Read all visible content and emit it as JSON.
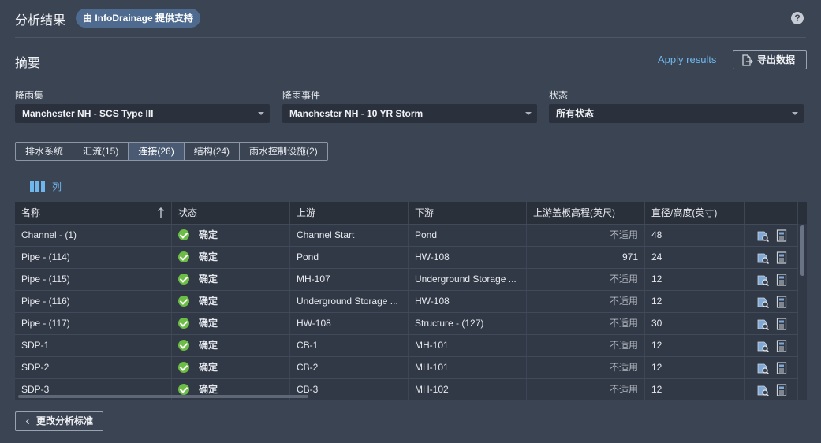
{
  "header": {
    "title": "分析结果",
    "badge": "由 InfoDrainage 提供支持",
    "help": "?"
  },
  "summary": {
    "title": "摘要",
    "apply_label": "Apply results",
    "export_label": "导出数据"
  },
  "filters": {
    "rainfall_set": {
      "label": "降雨集",
      "value": "Manchester NH - SCS Type III"
    },
    "rainfall_event": {
      "label": "降雨事件",
      "value": "Manchester NH - 10 YR Storm"
    },
    "status": {
      "label": "状态",
      "value": "所有状态"
    }
  },
  "tabs": [
    {
      "label": "排水系统",
      "active": false
    },
    {
      "label": "汇流(15)",
      "active": false
    },
    {
      "label": "连接(26)",
      "active": true
    },
    {
      "label": "结构(24)",
      "active": false
    },
    {
      "label": "雨水控制设施(2)",
      "active": false
    }
  ],
  "columns_button": "列",
  "table": {
    "headers": [
      "名称",
      "状态",
      "上游",
      "下游",
      "上游盖板高程(英尺)",
      "直径/高度(英寸)"
    ],
    "rows": [
      {
        "name": "Channel - (1)",
        "status": "确定",
        "upstream": "Channel Start",
        "downstream": "Pond",
        "invert": "不适用",
        "diameter": "48"
      },
      {
        "name": "Pipe - (114)",
        "status": "确定",
        "upstream": "Pond",
        "downstream": "HW-108",
        "invert": "971",
        "diameter": "24"
      },
      {
        "name": "Pipe - (115)",
        "status": "确定",
        "upstream": "MH-107",
        "downstream": "Underground Storage ...",
        "invert": "不适用",
        "diameter": "12"
      },
      {
        "name": "Pipe - (116)",
        "status": "确定",
        "upstream": "Underground Storage ...",
        "downstream": "HW-108",
        "invert": "不适用",
        "diameter": "12"
      },
      {
        "name": "Pipe - (117)",
        "status": "确定",
        "upstream": "HW-108",
        "downstream": "Structure - (127)",
        "invert": "不适用",
        "diameter": "30"
      },
      {
        "name": "SDP-1",
        "status": "确定",
        "upstream": "CB-1",
        "downstream": "MH-101",
        "invert": "不适用",
        "diameter": "12"
      },
      {
        "name": "SDP-2",
        "status": "确定",
        "upstream": "CB-2",
        "downstream": "MH-101",
        "invert": "不适用",
        "diameter": "12"
      },
      {
        "name": "SDP-3",
        "status": "确定",
        "upstream": "CB-3",
        "downstream": "MH-102",
        "invert": "不适用",
        "diameter": "12"
      }
    ]
  },
  "footer": {
    "back_label": "更改分析标准"
  },
  "colors": {
    "background": "#3b4453",
    "accent": "#6fb6ec",
    "ok": "#6bbd45",
    "badge": "#4e6b8f"
  }
}
